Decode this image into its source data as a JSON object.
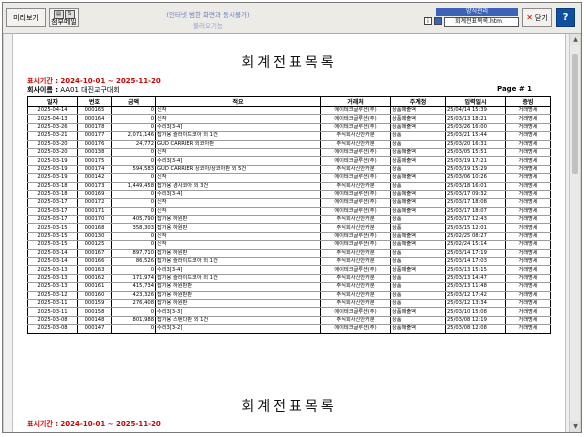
{
  "toolbar": {
    "preview_label": "미리보기",
    "attach_label": "첨부메일",
    "note1": "(인터넷 범한 화면과 동시볼가)",
    "note2": "불러오기능",
    "sample_tab": "양식관리",
    "file_name": "회계전표목록.htm",
    "close_label": "닫기",
    "help_label": "?"
  },
  "report": {
    "title": "회계전표목록",
    "period": "표시기간 : 2024-10-01 ~ 2025-11-20",
    "company_label": "회사이름 :",
    "company_value": "AA01 대진교구대회",
    "page": "Page # 1",
    "period_next": "표시기간 : 2024-10-01 ~ 2025-11-20"
  },
  "table": {
    "headers": [
      "일자",
      "번호",
      "금액",
      "적요",
      "거래처",
      "주계정",
      "입력일시",
      "증빙"
    ],
    "rows": [
      [
        "2025-04-14",
        "000165",
        "0",
        "신작",
        "에이테크글루션(주)",
        "상품매출액",
        "25/04/14 15:39",
        "거래명세"
      ],
      [
        "2025-04-13",
        "000164",
        "0",
        "신작",
        "에이테크글루션(주)",
        "상품매출액",
        "25/03/13 18:21",
        "거래명세"
      ],
      [
        "2025-03-26",
        "000178",
        "0",
        "수리3[3-4]",
        "에이테크글루션(주)",
        "상품매출액",
        "25/03/26 16:00",
        "거래명세"
      ],
      [
        "2025-03-21",
        "000177",
        "2,071,146",
        "잡가용 슬라이드코아 외 1건",
        "주식회사신안카분",
        "상품",
        "25/03/21 15:44",
        "거래명세"
      ],
      [
        "2025-03-20",
        "000176",
        "24,772",
        "GUD CARRIER 외코아판",
        "주식회사신안카분",
        "상품",
        "25/03/20 16:31",
        "거래명세"
      ],
      [
        "2025-03-20",
        "000138",
        "0",
        "신작",
        "에이테크글루션(주)",
        "상품매출액",
        "25/03/05 15:51",
        "거래명세"
      ],
      [
        "2025-03-19",
        "000175",
        "0",
        "수리3[3-4]",
        "에이테크글루션(주)",
        "상품매출액",
        "25/03/19 17:21",
        "거래명세"
      ],
      [
        "2025-03-19",
        "000174",
        "594,583",
        "GUD CARRIER 상코아/상코아판 외 5건",
        "주식회사신안카분",
        "상품",
        "25/03/19 15:29",
        "거래명세"
      ],
      [
        "2025-03-19",
        "000142",
        "0",
        "신작",
        "에이테크글루션(주)",
        "상품매출액",
        "25/03/06 10:26",
        "거래명세"
      ],
      [
        "2025-03-18",
        "000173",
        "1,449,458",
        "잡가용 경사코아 외 3건",
        "주식회사신안카분",
        "상품",
        "25/03/18 16:01",
        "거래명세"
      ],
      [
        "2025-03-18",
        "000169",
        "0",
        "수리3[3-4]",
        "에이테크글루션(주)",
        "상품매출액",
        "25/03/17 09:32",
        "거래명세"
      ],
      [
        "2025-03-17",
        "000172",
        "0",
        "신작",
        "에이테크글루션(주)",
        "상품매출액",
        "25/03/17 18:08",
        "거래명세"
      ],
      [
        "2025-03-17",
        "000171",
        "0",
        "신작",
        "에이테크글루션(주)",
        "상품매출액",
        "25/03/17 18:07",
        "거래명세"
      ],
      [
        "2025-03-17",
        "000170",
        "405,790",
        "잡가용 하원판",
        "주식회사신안카분",
        "상품",
        "25/03/17 12:43",
        "거래명세"
      ],
      [
        "2025-03-15",
        "000168",
        "358,303",
        "잡가용 하원판",
        "주식회사신안카분",
        "상품",
        "25/03/15 12:01",
        "거래명세"
      ],
      [
        "2025-03-15",
        "000130",
        "0",
        "신작",
        "에이테크글루션(주)",
        "상품매출액",
        "25/02/25 08:27",
        "거래명세"
      ],
      [
        "2025-03-15",
        "000125",
        "0",
        "신작",
        "에이테크글루션(주)",
        "상품매출액",
        "25/02/24 15:14",
        "거래명세"
      ],
      [
        "2025-03-14",
        "000167",
        "897,710",
        "잡가용 하원판",
        "주식회사신안카분",
        "상품",
        "25/03/14 17:19",
        "거래명세"
      ],
      [
        "2025-03-14",
        "000166",
        "86,526",
        "잡가용 슬라이드코아 외 1건",
        "주식회사신안카분",
        "상품",
        "25/03/14 17:03",
        "거래명세"
      ],
      [
        "2025-03-13",
        "000163",
        "0",
        "수리3[3-4]",
        "에이테크글루션(주)",
        "상품매출액",
        "25/03/13 15:15",
        "거래명세"
      ],
      [
        "2025-03-13",
        "000162",
        "171,974",
        "잡가용 슬라이드코아 외 1건",
        "주식회사신안카분",
        "상품",
        "25/03/13 14:47",
        "거래명세"
      ],
      [
        "2025-03-13",
        "000161",
        "415,734",
        "잡가용 하원판판",
        "주식회사신안카분",
        "상품",
        "25/03/13 11:48",
        "거래명세"
      ],
      [
        "2025-03-12",
        "000160",
        "423,326",
        "잡가용 하원판판",
        "주식회사신안카분",
        "상품",
        "25/03/12 17:42",
        "거래명세"
      ],
      [
        "2025-03-11",
        "000159",
        "276,408",
        "잡가용 하원판",
        "주식회사신안카분",
        "상품",
        "25/03/12 13:34",
        "거래명세"
      ],
      [
        "2025-03-11",
        "000158",
        "0",
        "수리3[3-3]",
        "에이테크글루션(주)",
        "상품매출액",
        "25/03/10 15:08",
        "거래명세"
      ],
      [
        "2025-03-08",
        "000148",
        "801,988",
        "잡가용 스텐다판 외 1건",
        "주식회사신안카분",
        "상품",
        "25/03/08 12:19",
        "거래명세"
      ],
      [
        "2025-03-08",
        "000147",
        "0",
        "수리3[3-2]",
        "에이테크글루션(주)",
        "상품매출액",
        "25/03/08 12:08",
        "거래명세"
      ]
    ]
  }
}
